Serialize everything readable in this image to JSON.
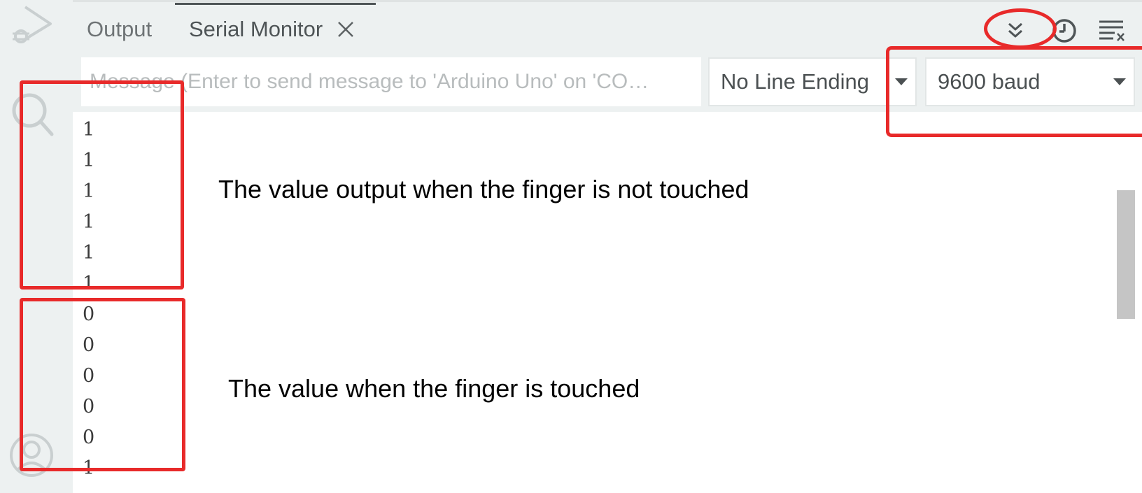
{
  "activity_bar": {
    "icons": [
      "debug-icon",
      "search-icon",
      "account-icon"
    ]
  },
  "panel": {
    "tabs": [
      {
        "label": "Output",
        "active": false
      },
      {
        "label": "Serial Monitor",
        "active": true,
        "closable": true
      }
    ],
    "toolbar_icons": [
      "toggle-autoscroll-icon",
      "toggle-timestamp-icon",
      "clear-output-icon"
    ]
  },
  "serial": {
    "message_placeholder": "Message (Enter to send message to 'Arduino Uno' on 'CO…",
    "line_ending": "No Line Ending",
    "baud_rate": "9600 baud",
    "output_lines": [
      "1",
      "1",
      "1",
      "1",
      "1",
      "1",
      "0",
      "0",
      "0",
      "0",
      "0",
      "1"
    ]
  },
  "annotations": {
    "not_touched": "The value output when the finger is not touched",
    "touched": "The value when the finger is touched"
  },
  "colors": {
    "markup_red": "#e82a2a",
    "panel_bg": "#edf1f1"
  }
}
